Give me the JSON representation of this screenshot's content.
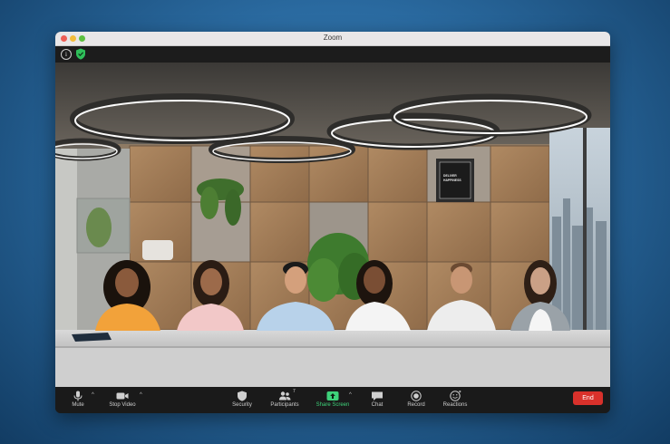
{
  "window": {
    "title": "Zoom"
  },
  "topbar": {
    "info": "i"
  },
  "scene": {
    "wall_sign": [
      "DELIVER",
      "HAPPINESS"
    ]
  },
  "toolbar": {
    "mute": "Mute",
    "stop_video": "Stop Video",
    "security": "Security",
    "participants": "Participants",
    "participants_count": "7",
    "share_screen": "Share Screen",
    "chat": "Chat",
    "record": "Record",
    "reactions": "Reactions",
    "end": "End"
  },
  "colors": {
    "share_accent": "#3ed27a",
    "end_button": "#d9312b",
    "security_badge": "#2fbf5a"
  }
}
